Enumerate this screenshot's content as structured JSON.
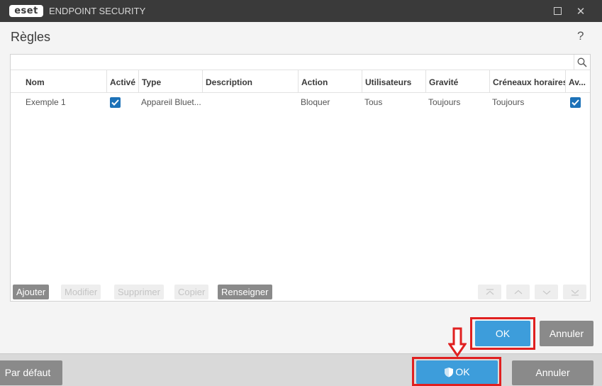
{
  "window": {
    "logo_text": "eset",
    "title": "ENDPOINT SECURITY"
  },
  "dialog": {
    "title": "Règles",
    "help_label": "?"
  },
  "table": {
    "columns": [
      "Nom",
      "Activé",
      "Type",
      "Description",
      "Action",
      "Utilisateurs",
      "Gravité",
      "Créneaux horaires",
      "Av..."
    ],
    "rows": [
      {
        "nom": "Exemple 1",
        "active": true,
        "type": "Appareil Bluet...",
        "description": "",
        "action": "Bloquer",
        "utilisateurs": "Tous",
        "gravite": "Toujours",
        "creneaux": "Toujours",
        "avertir": true
      }
    ]
  },
  "toolbar": {
    "add": "Ajouter",
    "edit": "Modifier",
    "delete": "Supprimer",
    "copy": "Copier",
    "fill": "Renseigner"
  },
  "dialog_buttons": {
    "ok": "OK",
    "cancel": "Annuler"
  },
  "footer": {
    "default": "Par défaut",
    "ok": "OK",
    "cancel": "Annuler"
  },
  "colors": {
    "accent": "#3d9ddb",
    "checkbox": "#1d72b8",
    "highlight": "#e02020",
    "titlebar": "#3a3a3a"
  }
}
